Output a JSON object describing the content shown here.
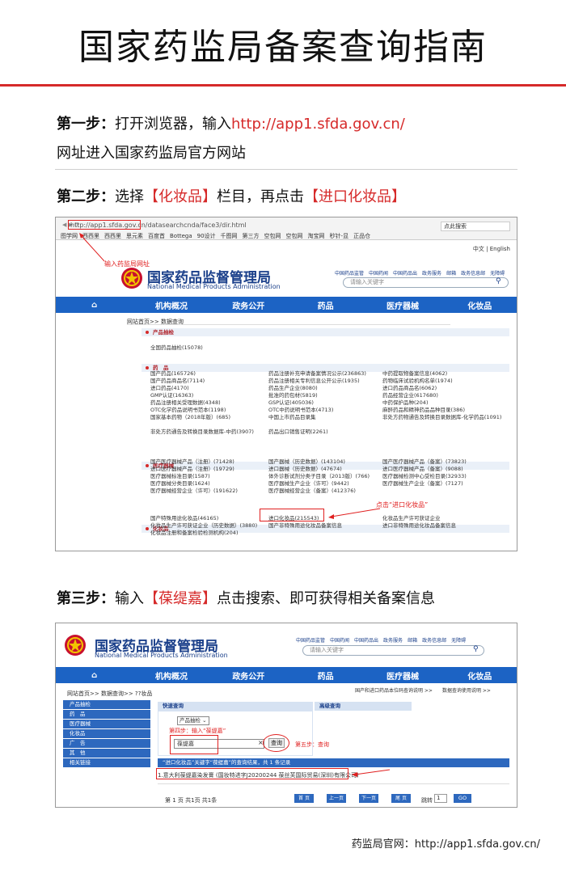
{
  "title": "国家药监局备案查询指南",
  "step1": {
    "label": "第一步：",
    "text_a": "打开浏览器，输入",
    "url": "http://app1.sfda.gov.cn/",
    "text_b": "网址进入国家药监局官方网站"
  },
  "step2": {
    "label": "第二步：",
    "text_a": "选择",
    "choice1": "【化妆品】",
    "text_b": "栏目，再点击",
    "choice2": "【进口化妆品】"
  },
  "step3": {
    "label": "第三步：",
    "text_a": "输入",
    "keyword": "【葆缇嘉】",
    "text_b": "点击搜索、即可获得相关备案信息"
  },
  "shot1": {
    "address": "http://app1.sfda.gov.cn/datasearchcnda/face3/dir.html",
    "address_hl": "http://app1.sfda.gov.cn",
    "search_box": "点此搜索",
    "bookmarks": [
      "图学网",
      "西西里",
      "西西里",
      "思元素",
      "百度首",
      "Bottega",
      "90设计",
      "千图网",
      "第三方",
      "空包网",
      "空包网",
      "淘宝网",
      "秒针-显",
      "正品仓"
    ],
    "top_right": "中文 | English",
    "annotation_url": "输入药监局网址",
    "org_cn": "国家药品监督管理局",
    "org_en": "National Medical Products Administration",
    "header_links": [
      "中国药品监管",
      "中国药闻",
      "中国药品出",
      "政务服务",
      "邮箱",
      "政务信息邮",
      "无障碍"
    ],
    "search_placeholder": "请输入关键字",
    "nav": [
      "⌂",
      "机构概况",
      "政务公开",
      "药品",
      "医疗器械",
      "化妆品"
    ],
    "breadcrumb": "网站首页>> 数据查询",
    "sections": {
      "s0": "产品抽检",
      "s0_item": "全国药品抽检(15078)",
      "s1": "药　品",
      "s1_col1": [
        "国产药品(165726)",
        "国产药品商品名(7114)",
        "进口药品(4170)",
        "GMP认证(16363)",
        "药品注册相关受理数据(4348)",
        "OTC化学药品说明书范本(1198)",
        "国家基本药物（2018年版）(685)",
        "非处方药通告及转换目录数据库-中药(3907)"
      ],
      "s1_col2": [
        "药品注册补充申请备案情况公示(236863)",
        "药品注册相关专利信息公开公示(1935)",
        "药品生产企业(8080)",
        "批准的药包材(5819)",
        "GSP认证(405036)",
        "OTC中药说明书范本(4713)",
        "中国上市药品目录集",
        "药品出口销售证明(2261)"
      ],
      "s1_col3": [
        "中药提取物备案信息(4062)",
        "药物临床试验机构名单(1974)",
        "进口药品商品名(6062)",
        "药品经营企业(617680)",
        "中药保护品种(204)",
        "麻醉药品和精神药品品种目录(386)",
        "非处方药物通告及转换目录数据库-化学药品(1091)"
      ],
      "s2": "医疗器械",
      "s2_col1": [
        "国产医疗器械产品（注册）(71428)",
        "进口医疗器械产品（注册）(19729)",
        "医疗器械标准目录(1587)",
        "医疗器械分类目录(1624)",
        "医疗器械经营企业（许可）(191622)"
      ],
      "s2_col2": [
        "国产器械（历史数据）(143104)",
        "进口器械（历史数据）(47674)",
        "体外诊断试剂分类子目录（2013版）(766)",
        "医疗器械生产企业（许可）(9442)",
        "医疗器械经营企业（备案）(412376)"
      ],
      "s2_col3": [
        "国产医疗器械产品（备案）(73823)",
        "进口医疗器械产品（备案）(9088)",
        "医疗器械检测中心受检目录(32933)",
        "医疗器械生产企业（备案）(7127)"
      ],
      "s3": "化妆品",
      "s3_col1": [
        "国产特殊用途化妆品(46165)",
        "化妆品生产许可获证企业（历史数据）(3880)",
        "化妆品注册和备案检验检测机构(204)"
      ],
      "s3_col2": [
        "进口化妆品(215543)",
        "国产非特殊用途化妆品备案信息"
      ],
      "s3_col3": [
        "化妆品生产许可获证企业",
        "进口非特殊用途化妆品备案信息"
      ],
      "s4": "广　告"
    },
    "annotation_click": "点击“进口化妆品”"
  },
  "shot2": {
    "org_cn": "国家药品监督管理局",
    "org_en": "National Medical Products Administration",
    "header_links": [
      "中国药品监管",
      "中国药闻",
      "中国药品出",
      "政务服务",
      "邮箱",
      "政务信息邮",
      "无障碍"
    ],
    "search_placeholder": "请输入关键字",
    "nav": [
      "⌂",
      "机构概况",
      "政务公开",
      "药品",
      "医疗器械",
      "化妆品"
    ],
    "sub_links": "国产和进口药品本位码查询说明 >>　　数据查询使用说明 >>",
    "breadcrumb": "网站首页>> 数据查询>> ??妆品",
    "sidebar": [
      "产品抽检",
      "药　品",
      "医疗器械",
      "化妆品",
      "广　告",
      "其　他",
      "相关链接"
    ],
    "quick_search": "快速查询",
    "adv_search": "高级查询",
    "select_value": "产品抽检",
    "step4": "第四步：输入“葆缇嘉”",
    "input_value": "葆缇嘉",
    "query_btn": "查询",
    "step5": "第五步：查询",
    "result_head": "“进口化妆品”关键字“葆缇嘉”的查询结果，共 1 条记录",
    "result_row": "1.意大利葆缇嘉染发膏 (国妆特进字J20200244 葆丝芙国际贸易(深圳)有限公司)",
    "pager_text": "第 1 页 共1页 共1条",
    "pager_btns": [
      "首 页",
      "上一页",
      "下一页",
      "尾 页"
    ],
    "jump_label": "跳转",
    "jump_value": "1",
    "go": "GO"
  },
  "footer": "药监局官网：http://app1.sfda.gov.cn/"
}
